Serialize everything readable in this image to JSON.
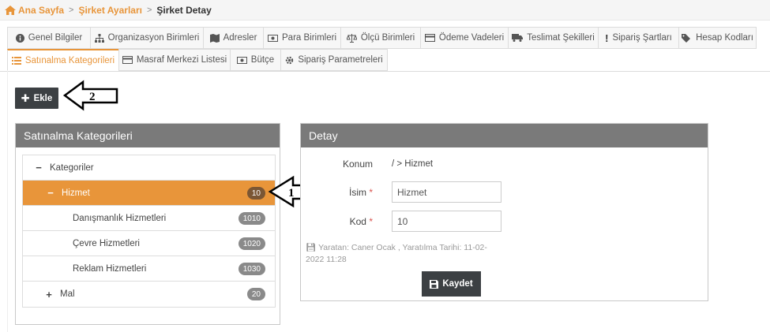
{
  "breadcrumb": {
    "home": "Ana Sayfa",
    "settings": "Şirket Ayarları",
    "current": "Şirket Detay"
  },
  "tabs_row1": [
    {
      "label": "Genel Bilgiler",
      "icon": "info-icon"
    },
    {
      "label": "Organizasyon Birimleri",
      "icon": "sitemap-icon"
    },
    {
      "label": "Adresler",
      "icon": "map-icon"
    },
    {
      "label": "Para Birimleri",
      "icon": "money-icon"
    },
    {
      "label": "Ölçü Birimleri",
      "icon": "balance-scale-icon"
    },
    {
      "label": "Ödeme Vadeleri",
      "icon": "credit-card-icon"
    },
    {
      "label": "Teslimat Şekilleri",
      "icon": "truck-icon"
    },
    {
      "label": "Sipariş Şartları",
      "icon": "exclamation-icon"
    },
    {
      "label": "Hesap Kodları",
      "icon": "tags-icon"
    }
  ],
  "tabs_row2": [
    {
      "label": "Satınalma Kategorileri",
      "icon": "list-icon",
      "active": true
    },
    {
      "label": "Masraf Merkezi Listesi",
      "icon": "credit-card-icon"
    },
    {
      "label": "Bütçe",
      "icon": "money-icon"
    },
    {
      "label": "Sipariş Parametreleri",
      "icon": "gear-icon"
    }
  ],
  "toolbar": {
    "add_label": "Ekle"
  },
  "left_panel": {
    "title": "Satınalma Kategorileri",
    "tree": [
      {
        "label": "Kategoriler",
        "toggle": "−",
        "level": 0
      },
      {
        "label": "Hizmet",
        "toggle": "−",
        "level": 1,
        "badge": "10",
        "selected": true
      },
      {
        "label": "Danışmanlık Hizmetleri",
        "level": 2,
        "badge": "1010"
      },
      {
        "label": "Çevre Hizmetleri",
        "level": 2,
        "badge": "1020"
      },
      {
        "label": "Reklam Hizmetleri",
        "level": 2,
        "badge": "1030"
      },
      {
        "label": "Mal",
        "toggle": "+",
        "level": 1,
        "badge": "20"
      }
    ]
  },
  "right_panel": {
    "title": "Detay",
    "location_label": "Konum",
    "location_value": "/ > Hizmet",
    "name_label": "İsim",
    "name_value": "Hizmet",
    "code_label": "Kod",
    "code_value": "10",
    "required_mark": "*",
    "meta_line1": "Yaratan: Caner Ocak , Yaratılma Tarihi: 11-02-",
    "meta_line2": "2022 11:28",
    "save_label": "Kaydet"
  },
  "annotations": {
    "arrow1": "1",
    "arrow2": "2"
  },
  "colors": {
    "accent": "#e8953a",
    "dark_button": "#3c4043",
    "panel_header": "#7a7a7a",
    "badge": "#8a8a8a"
  }
}
